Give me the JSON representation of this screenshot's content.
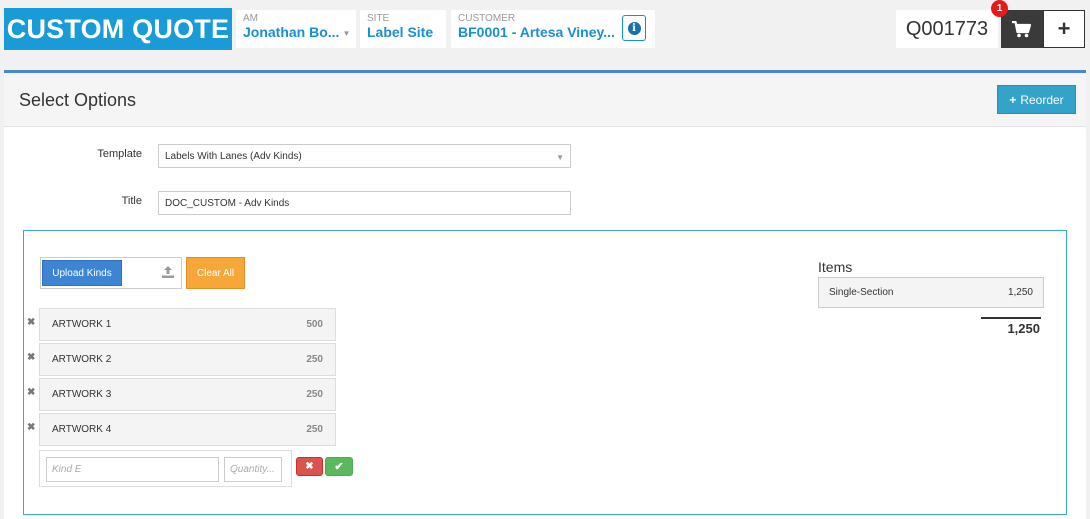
{
  "header": {
    "brand": "CUSTOM QUOTE",
    "am": {
      "label": "AM",
      "value": "Jonathan Bo..."
    },
    "site": {
      "label": "SITE",
      "value": "Label Site"
    },
    "customer": {
      "label": "CUSTOMER",
      "value": "BF0001 - Artesa Viney..."
    },
    "quote_number": "Q001773",
    "cart_badge": "1",
    "add_label": "+"
  },
  "panel": {
    "title": "Select Options",
    "reorder_label": "Reorder"
  },
  "form": {
    "template_label": "Template",
    "template_value": "Labels With Lanes (Adv Kinds)",
    "title_label": "Title",
    "title_value": "DOC_CUSTOM - Adv Kinds"
  },
  "kinds": {
    "upload_label": "Upload Kinds",
    "clear_label": "Clear All",
    "list": [
      {
        "name": "ARTWORK 1",
        "qty": "500"
      },
      {
        "name": "ARTWORK 2",
        "qty": "250"
      },
      {
        "name": "ARTWORK 3",
        "qty": "250"
      },
      {
        "name": "ARTWORK 4",
        "qty": "250"
      }
    ],
    "new_kind_placeholder": "Kind E",
    "new_qty_placeholder": "Quantity..."
  },
  "items": {
    "title": "Items",
    "rows": [
      {
        "name": "Single-Section",
        "qty": "1,250"
      }
    ],
    "total": "1,250"
  },
  "colors": {
    "brand": "#1a9bd7",
    "accent_blue": "#3d84d4",
    "orange": "#f6a738",
    "danger": "#d9534f",
    "success": "#5cb85c"
  }
}
